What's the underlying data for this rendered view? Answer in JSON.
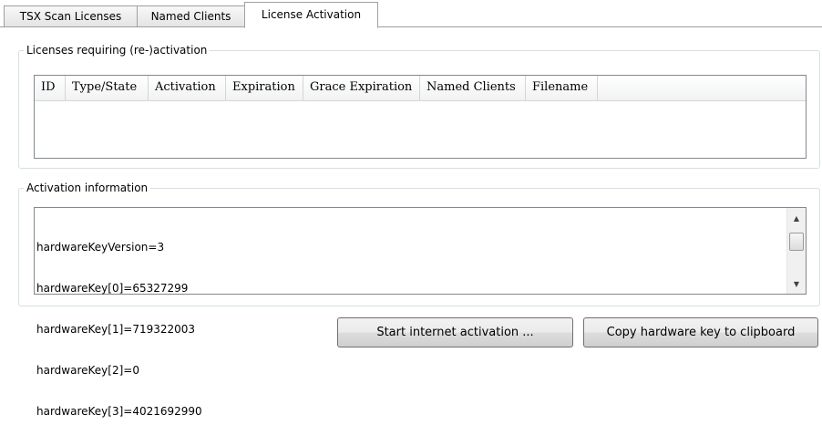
{
  "tabs": [
    {
      "label": "TSX Scan Licenses",
      "active": false
    },
    {
      "label": "Named Clients",
      "active": false
    },
    {
      "label": "License Activation",
      "active": true
    }
  ],
  "licenses_group": {
    "title": "Licenses requiring (re-)activation",
    "columns": [
      "ID",
      "Type/State",
      "Activation",
      "Expiration",
      "Grace Expiration",
      "Named Clients",
      "Filename"
    ],
    "rows": []
  },
  "activation_group": {
    "title": "Activation information",
    "lines": [
      "hardwareKeyVersion=3",
      "hardwareKey[0]=65327299",
      "hardwareKey[1]=719322003",
      "hardwareKey[2]=0",
      "hardwareKey[3]=4021692990"
    ]
  },
  "buttons": {
    "start_activation": "Start internet activation ...",
    "copy_key": "Copy hardware key to clipboard"
  }
}
